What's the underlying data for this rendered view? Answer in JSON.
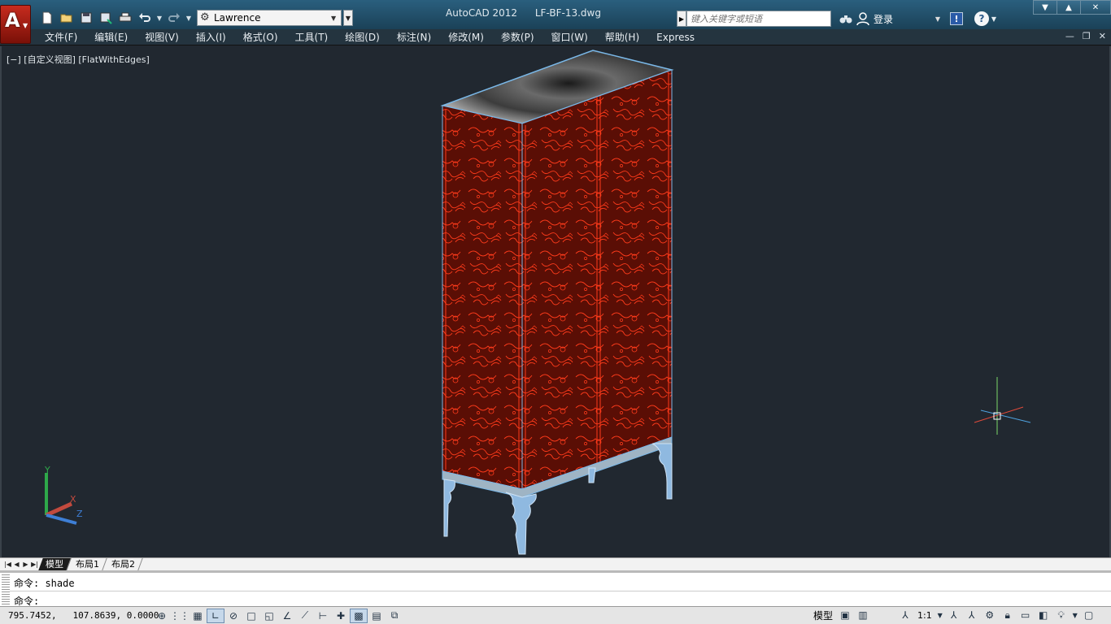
{
  "app": {
    "logo_letter": "A",
    "title": "AutoCAD 2012",
    "document": "LF-BF-13.dwg"
  },
  "workspace": {
    "value": "Lawrence"
  },
  "infocenter": {
    "search_placeholder": "键入关键字或短语",
    "signin_label": "登录"
  },
  "menu": [
    "文件(F)",
    "编辑(E)",
    "视图(V)",
    "插入(I)",
    "格式(O)",
    "工具(T)",
    "绘图(D)",
    "标注(N)",
    "修改(M)",
    "参数(P)",
    "窗口(W)",
    "帮助(H)",
    "Express"
  ],
  "viewport": {
    "label": "[−] [自定义视图] [FlatWithEdges]"
  },
  "layout_tabs": [
    "模型",
    "布局1",
    "布局2"
  ],
  "ucs": {
    "x_label": "X",
    "y_label": "Y",
    "z_label": "Z"
  },
  "command": {
    "history": "命令: shade",
    "prompt": "命令:"
  },
  "status": {
    "coordinates": "795.7452,   107.8639, 0.0000",
    "model_label": "模型",
    "annotation_scale": "1:1"
  },
  "colors": {
    "canvas": "#212830",
    "titlebar": "#1b4157",
    "cabinet_panel": "#5a0e05",
    "cabinet_pattern": "#ff3a1a",
    "cabinet_edges": "#7ab8e8",
    "top_surface": "#8a8a8a"
  }
}
